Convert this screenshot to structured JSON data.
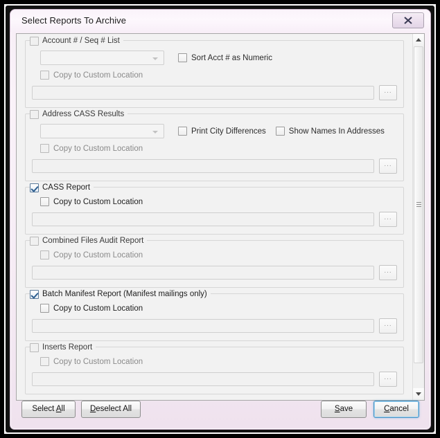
{
  "window": {
    "title": "Select Reports To Archive",
    "close_icon": "close-x-icon",
    "close_label": "X"
  },
  "scrollbar": {
    "up_icon": "scroll-up-arrow-icon",
    "down_icon": "scroll-down-arrow-icon",
    "grip_icon": "scroll-thumb-grip-icon"
  },
  "common": {
    "copy_to_custom_location": "Copy to Custom Location",
    "browse_label": "...",
    "combo_placeholder": "",
    "path_value": "",
    "dropdown_icon": "chevron-down-icon"
  },
  "sections": [
    {
      "id": "account-seq-list",
      "title": "Account # / Seq # List",
      "checked": false,
      "enabled": false,
      "has_combo": true,
      "options": [],
      "selected": "",
      "extra_checkboxes": [
        {
          "id": "sort-acct-numeric",
          "label": "Sort Acct # as Numeric",
          "checked": false
        }
      ],
      "copy_label": "Copy to Custom Location",
      "copy_checked": false,
      "path_value": ""
    },
    {
      "id": "address-cass-results",
      "title": "Address CASS Results",
      "checked": false,
      "enabled": false,
      "has_combo": true,
      "options": [],
      "selected": "",
      "extra_checkboxes": [
        {
          "id": "print-city-differences",
          "label": "Print City Differences",
          "checked": false
        },
        {
          "id": "show-names-in-addresses",
          "label": "Show Names In Addresses",
          "checked": false
        }
      ],
      "copy_label": "Copy to Custom Location",
      "copy_checked": false,
      "path_value": ""
    },
    {
      "id": "cass-report",
      "title": "CASS Report",
      "checked": true,
      "enabled": true,
      "has_combo": false,
      "extra_checkboxes": [],
      "copy_label": "Copy to Custom Location",
      "copy_checked": false,
      "path_value": ""
    },
    {
      "id": "combined-files-audit-report",
      "title": "Combined Files Audit Report",
      "checked": false,
      "enabled": false,
      "has_combo": false,
      "extra_checkboxes": [],
      "copy_label": "Copy to Custom Location",
      "copy_checked": false,
      "path_value": ""
    },
    {
      "id": "batch-manifest-report",
      "title": "Batch Manifest Report (Manifest mailings only)",
      "checked": true,
      "enabled": true,
      "has_combo": false,
      "extra_checkboxes": [],
      "copy_label": "Copy to Custom Location",
      "copy_checked": false,
      "path_value": ""
    },
    {
      "id": "inserts-report",
      "title": "Inserts Report",
      "checked": false,
      "enabled": false,
      "has_combo": false,
      "extra_checkboxes": [],
      "copy_label": "Copy to Custom Location",
      "copy_checked": false,
      "path_value": ""
    }
  ],
  "footer": {
    "select_all": {
      "label": "Select All",
      "accel": "A"
    },
    "deselect_all": {
      "label": "Deselect All",
      "accel": "D"
    },
    "save": {
      "label": "Save",
      "accel": "S"
    },
    "cancel": {
      "label": "Cancel",
      "accel": "C",
      "focused": true
    }
  },
  "colors": {
    "frame": "#f6ecf5",
    "accent_focus": "#4a93c4",
    "check": "#2c5d8f",
    "panel": "#f2f2f2"
  }
}
